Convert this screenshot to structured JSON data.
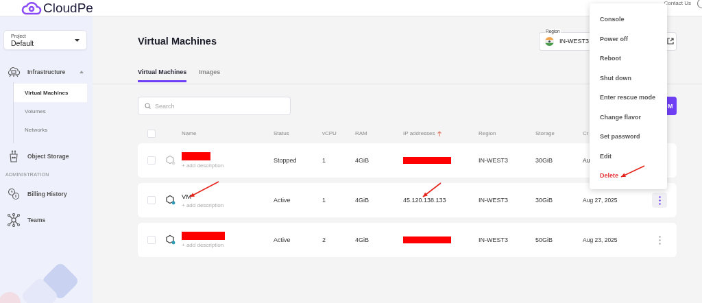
{
  "brand": {
    "name": "CloudPe"
  },
  "header": {
    "help_link": "Contact Us"
  },
  "sidebar": {
    "project": {
      "label": "Project",
      "value": "Default"
    },
    "items": [
      {
        "kind": "group",
        "label": "Infrastructure",
        "expanded": true,
        "children": [
          {
            "label": "Virtual Machines",
            "selected": true
          },
          {
            "label": "Volumes",
            "selected": false
          },
          {
            "label": "Networks",
            "selected": false
          }
        ]
      },
      {
        "kind": "link",
        "label": "Object Storage"
      },
      {
        "kind": "heading",
        "label": "ADMINISTRATION"
      },
      {
        "kind": "link",
        "label": "Billing History"
      },
      {
        "kind": "link",
        "label": "Teams"
      }
    ]
  },
  "page": {
    "title": "Virtual Machines",
    "region": {
      "label": "Region",
      "value": "IN-WEST3"
    },
    "tabs": [
      {
        "label": "Virtual Machines",
        "selected": true
      },
      {
        "label": "Images",
        "selected": false
      }
    ],
    "search": {
      "placeholder": "Search"
    },
    "create_button": "M"
  },
  "table": {
    "all_selected": false,
    "columns": [
      {
        "label": "Name",
        "sorted": false
      },
      {
        "label": "Status",
        "sorted": false
      },
      {
        "label": "vCPU",
        "sorted": false
      },
      {
        "label": "RAM",
        "sorted": false
      },
      {
        "label": "IP addresses",
        "sorted": true
      },
      {
        "label": "Region",
        "sorted": false
      },
      {
        "label": "Storage",
        "sorted": false
      },
      {
        "label": "Cr",
        "sorted": false
      }
    ],
    "rows": [
      {
        "selected": false,
        "name_redacted": true,
        "name_arrow": false,
        "description": "+ add description",
        "running": false,
        "status": "Stopped",
        "vcpu": "1",
        "ram": "4GiB",
        "ip_redacted": true,
        "ip_arrow": false,
        "region": "IN-WEST3",
        "storage": "30GiB",
        "created": "Au",
        "menu_open": false
      },
      {
        "selected": false,
        "name": "VM",
        "name_redacted": false,
        "name_arrow": true,
        "description": "+ add description",
        "running": true,
        "status": "Active",
        "vcpu": "1",
        "ram": "4GiB",
        "ip": "45.120.138.133",
        "ip_redacted": false,
        "ip_arrow": true,
        "region": "IN-WEST3",
        "storage": "30GiB",
        "created": "Aug 27, 2025",
        "menu_open": true
      },
      {
        "selected": false,
        "name_redacted": true,
        "name_arrow": false,
        "description": "+ add description",
        "running": true,
        "status": "Active",
        "vcpu": "2",
        "ram": "4GiB",
        "ip_redacted": true,
        "ip_arrow": false,
        "region": "IN-WEST3",
        "storage": "50GiB",
        "created": "Aug 23, 2025",
        "menu_open": false
      }
    ]
  },
  "row_menu": {
    "items": [
      {
        "label": "Console",
        "danger": false,
        "arrow": false
      },
      {
        "label": "Power off",
        "danger": false,
        "arrow": false
      },
      {
        "label": "Reboot",
        "danger": false,
        "arrow": false
      },
      {
        "label": "Shut down",
        "danger": false,
        "arrow": false
      },
      {
        "label": "Enter rescue mode",
        "danger": false,
        "arrow": false
      },
      {
        "label": "Change flavor",
        "danger": false,
        "arrow": false
      },
      {
        "label": "Set password",
        "danger": false,
        "arrow": false
      },
      {
        "label": "Edit",
        "danger": false,
        "arrow": false
      },
      {
        "label": "Delete",
        "danger": true,
        "arrow": true
      }
    ]
  }
}
